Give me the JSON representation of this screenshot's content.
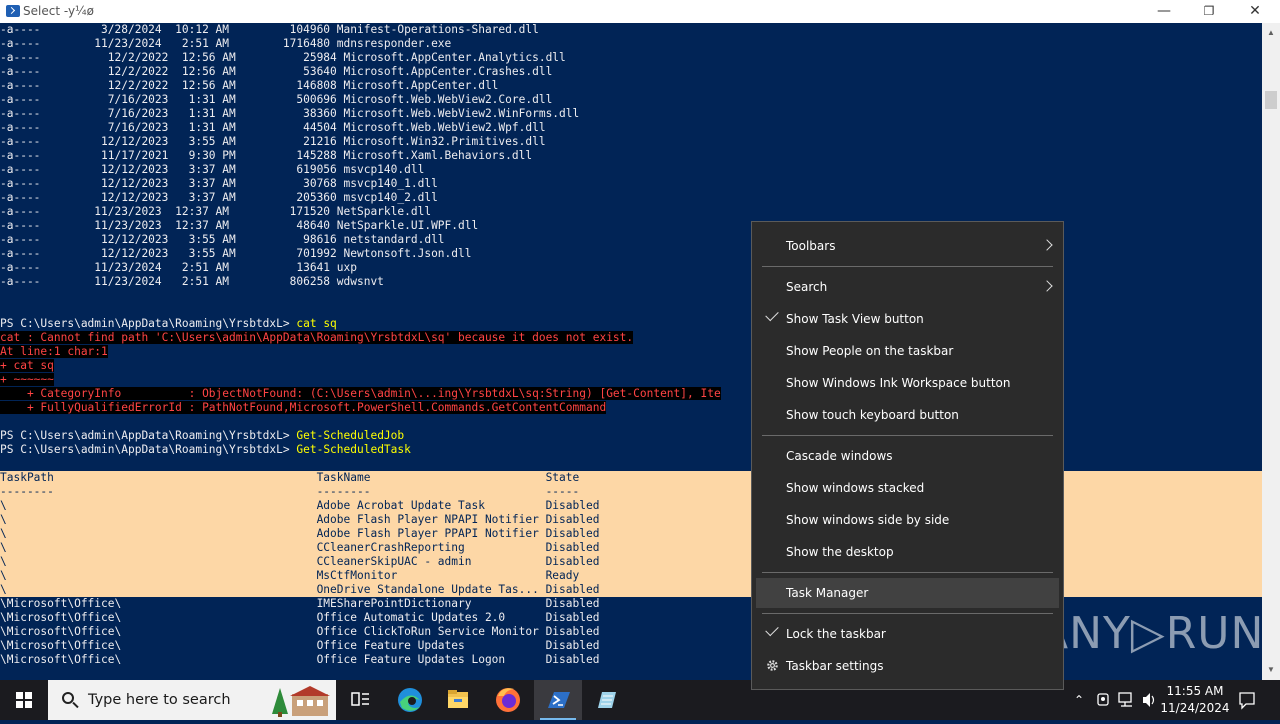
{
  "window": {
    "title": "Select -y¼ø",
    "minimize": "—",
    "maximize": "❐",
    "close": "✕"
  },
  "console": {
    "listing": [
      "-a----         3/28/2024  10:12 AM         104960 Manifest-Operations-Shared.dll",
      "-a----        11/23/2024   2:51 AM        1716480 mdnsresponder.exe",
      "-a----          12/2/2022  12:56 AM          25984 Microsoft.AppCenter.Analytics.dll",
      "-a----          12/2/2022  12:56 AM          53640 Microsoft.AppCenter.Crashes.dll",
      "-a----          12/2/2022  12:56 AM         146808 Microsoft.AppCenter.dll",
      "-a----          7/16/2023   1:31 AM         500696 Microsoft.Web.WebView2.Core.dll",
      "-a----          7/16/2023   1:31 AM          38360 Microsoft.Web.WebView2.WinForms.dll",
      "-a----          7/16/2023   1:31 AM          44504 Microsoft.Web.WebView2.Wpf.dll",
      "-a----         12/12/2023   3:55 AM          21216 Microsoft.Win32.Primitives.dll",
      "-a----         11/17/2021   9:30 PM         145288 Microsoft.Xaml.Behaviors.dll",
      "-a----         12/12/2023   3:37 AM         619056 msvcp140.dll",
      "-a----         12/12/2023   3:37 AM          30768 msvcp140_1.dll",
      "-a----         12/12/2023   3:37 AM         205360 msvcp140_2.dll",
      "-a----        11/23/2023  12:37 AM         171520 NetSparkle.dll",
      "-a----        11/23/2023  12:37 AM          48640 NetSparkle.UI.WPF.dll",
      "-a----         12/12/2023   3:55 AM          98616 netstandard.dll",
      "-a----         12/12/2023   3:55 AM         701992 Newtonsoft.Json.dll",
      "-a----        11/23/2024   2:51 AM          13641 uxp",
      "-a----        11/23/2024   2:51 AM         806258 wdwsnvt"
    ],
    "prompt1": "PS C:\\Users\\admin\\AppData\\Roaming\\YrsbtdxL> ",
    "cmd1": "cat sq",
    "err1": "cat : Cannot find path 'C:\\Users\\admin\\AppData\\Roaming\\YrsbtdxL\\sq' because it does not exist.",
    "err2": "At line:1 char:1",
    "err3": "+ cat sq",
    "err4": "+ ~~~~~~",
    "err5": "    + CategoryInfo          : ObjectNotFound: (C:\\Users\\admin\\...ing\\YrsbtdxL\\sq:String) [Get-Content], Ite",
    "err6": "    + FullyQualifiedErrorId : PathNotFound,Microsoft.PowerShell.Commands.GetContentCommand",
    "prompt2": "PS C:\\Users\\admin\\AppData\\Roaming\\YrsbtdxL> ",
    "cmd2": "Get-ScheduledJob",
    "prompt3": "PS C:\\Users\\admin\\AppData\\Roaming\\YrsbtdxL> ",
    "cmd3": "Get-ScheduledTask",
    "table_header": "TaskPath                                       TaskName                          State",
    "table_rule": "--------                                       --------                          -----",
    "tasks": [
      "\\                                              Adobe Acrobat Update Task         Disabled",
      "\\                                              Adobe Flash Player NPAPI Notifier Disabled",
      "\\                                              Adobe Flash Player PPAPI Notifier Disabled",
      "\\                                              CCleanerCrashReporting            Disabled",
      "\\                                              CCleanerSkipUAC - admin           Disabled",
      "\\                                              MsCtfMonitor                      Ready",
      "\\                                              OneDrive Standalone Update Tas... Disabled",
      "\\Microsoft\\Office\\                             IMESharePointDictionary           Disabled",
      "\\Microsoft\\Office\\                             Office Automatic Updates 2.0      Disabled",
      "\\Microsoft\\Office\\                             Office ClickToRun Service Monitor Disabled",
      "\\Microsoft\\Office\\                             Office Feature Updates            Disabled",
      "\\Microsoft\\Office\\                             Office Feature Updates Logon      Disabled"
    ]
  },
  "context_menu": {
    "items": [
      {
        "label": "Toolbars",
        "submenu": true
      },
      {
        "label": "Search",
        "submenu": true
      },
      {
        "label": "Show Task View button",
        "checked": true
      },
      {
        "label": "Show People on the taskbar"
      },
      {
        "label": "Show Windows Ink Workspace button"
      },
      {
        "label": "Show touch keyboard button"
      },
      {
        "label": "Cascade windows"
      },
      {
        "label": "Show windows stacked"
      },
      {
        "label": "Show windows side by side"
      },
      {
        "label": "Show the desktop"
      },
      {
        "label": "Task Manager",
        "hovered": true
      },
      {
        "label": "Lock the taskbar",
        "checked": true
      },
      {
        "label": "Taskbar settings",
        "icon": "gear-icon"
      }
    ]
  },
  "taskbar": {
    "search_placeholder": "Type here to search",
    "time": "11:55 AM",
    "date": "11/24/2024",
    "apps": [
      "task-view-icon",
      "edge-icon",
      "file-explorer-icon",
      "firefox-icon",
      "powershell-icon",
      "notepad-icon"
    ]
  },
  "watermark": "ANY▷RUN",
  "colors": {
    "console_bg": "#012456",
    "selection": "#fdd7a6",
    "error": "#ff4444",
    "command": "#ffff00",
    "menu_bg": "#2b2b2b"
  }
}
